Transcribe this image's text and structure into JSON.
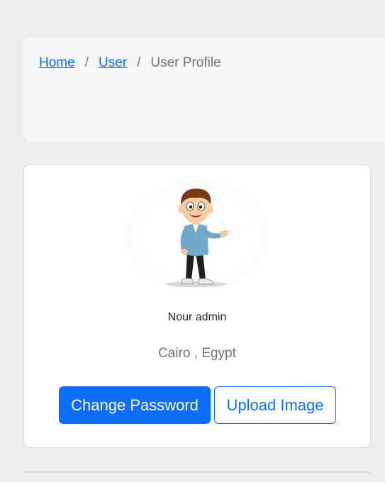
{
  "breadcrumb": {
    "items": [
      {
        "label": "Home",
        "link": true
      },
      {
        "label": "User",
        "link": true
      },
      {
        "label": "User Profile",
        "link": false
      }
    ],
    "separator": "/"
  },
  "profile": {
    "avatar_icon": "cartoon-man-avatar",
    "name": "Nour admin",
    "location": "Cairo , Egypt"
  },
  "actions": {
    "change_password_label": "Change Password",
    "upload_image_label": "Upload Image"
  },
  "colors": {
    "primary": "#0d6efd",
    "muted_text": "#6c757d",
    "page_bg": "#eeeeee",
    "panel_bg": "#f6f7f9"
  }
}
